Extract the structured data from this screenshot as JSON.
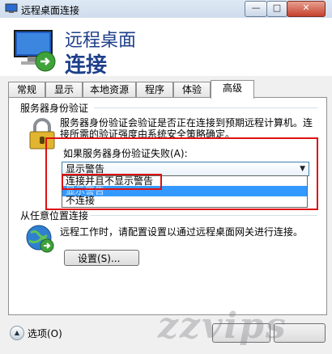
{
  "window": {
    "title": "远程桌面连接",
    "minimize": "—",
    "maximize": "□",
    "close": "✕"
  },
  "header": {
    "line1": "远程桌面",
    "line2": "连接"
  },
  "tabs": [
    {
      "label": "常规"
    },
    {
      "label": "显示"
    },
    {
      "label": "本地资源"
    },
    {
      "label": "程序"
    },
    {
      "label": "体验"
    },
    {
      "label": "高级",
      "active": true
    }
  ],
  "server_auth": {
    "group_label": "服务器身份验证",
    "description": "服务器身份验证会验证是否正在连接到预期远程计算机。连接所需的验证强度由系统安全策略确定。",
    "combo_label": "如果服务器身份验证失败(A):",
    "selected": "显示警告",
    "options": [
      "连接并且不显示警告",
      "显示警告",
      "不连接"
    ],
    "highlighted_index": 1
  },
  "anywhere": {
    "group_label": "从任意位置连接",
    "description": "远程工作时，请配置设置以通过远程桌面网关进行连接。",
    "settings_button": "设置(S)..."
  },
  "footer": {
    "options_label": "选项(O)"
  },
  "colors": {
    "title_blue": "#1e3f8a",
    "highlight": "#3399ff",
    "annotation_red": "#dd1111"
  }
}
